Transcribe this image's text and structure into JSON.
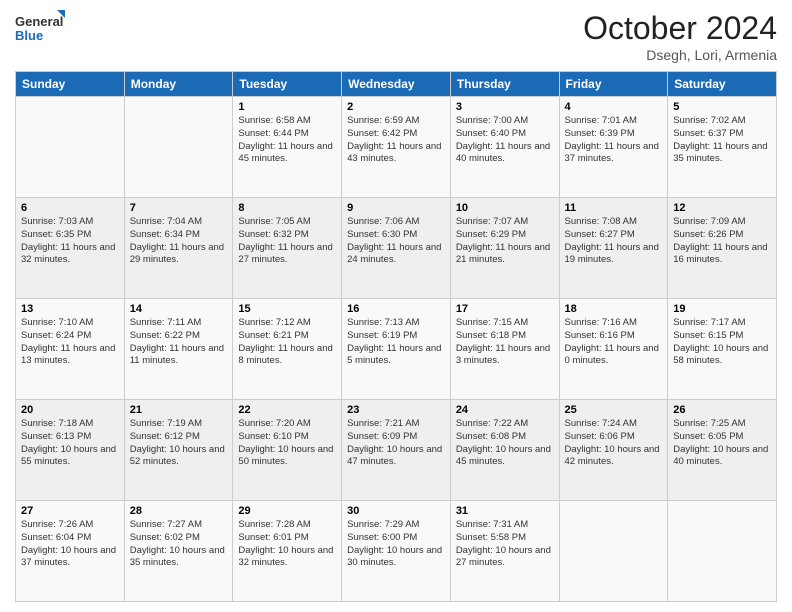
{
  "header": {
    "logo_general": "General",
    "logo_blue": "Blue",
    "month": "October 2024",
    "location": "Dsegh, Lori, Armenia"
  },
  "days_of_week": [
    "Sunday",
    "Monday",
    "Tuesday",
    "Wednesday",
    "Thursday",
    "Friday",
    "Saturday"
  ],
  "weeks": [
    [
      {
        "day": "",
        "info": ""
      },
      {
        "day": "",
        "info": ""
      },
      {
        "day": "1",
        "info": "Sunrise: 6:58 AM\nSunset: 6:44 PM\nDaylight: 11 hours and 45 minutes."
      },
      {
        "day": "2",
        "info": "Sunrise: 6:59 AM\nSunset: 6:42 PM\nDaylight: 11 hours and 43 minutes."
      },
      {
        "day": "3",
        "info": "Sunrise: 7:00 AM\nSunset: 6:40 PM\nDaylight: 11 hours and 40 minutes."
      },
      {
        "day": "4",
        "info": "Sunrise: 7:01 AM\nSunset: 6:39 PM\nDaylight: 11 hours and 37 minutes."
      },
      {
        "day": "5",
        "info": "Sunrise: 7:02 AM\nSunset: 6:37 PM\nDaylight: 11 hours and 35 minutes."
      }
    ],
    [
      {
        "day": "6",
        "info": "Sunrise: 7:03 AM\nSunset: 6:35 PM\nDaylight: 11 hours and 32 minutes."
      },
      {
        "day": "7",
        "info": "Sunrise: 7:04 AM\nSunset: 6:34 PM\nDaylight: 11 hours and 29 minutes."
      },
      {
        "day": "8",
        "info": "Sunrise: 7:05 AM\nSunset: 6:32 PM\nDaylight: 11 hours and 27 minutes."
      },
      {
        "day": "9",
        "info": "Sunrise: 7:06 AM\nSunset: 6:30 PM\nDaylight: 11 hours and 24 minutes."
      },
      {
        "day": "10",
        "info": "Sunrise: 7:07 AM\nSunset: 6:29 PM\nDaylight: 11 hours and 21 minutes."
      },
      {
        "day": "11",
        "info": "Sunrise: 7:08 AM\nSunset: 6:27 PM\nDaylight: 11 hours and 19 minutes."
      },
      {
        "day": "12",
        "info": "Sunrise: 7:09 AM\nSunset: 6:26 PM\nDaylight: 11 hours and 16 minutes."
      }
    ],
    [
      {
        "day": "13",
        "info": "Sunrise: 7:10 AM\nSunset: 6:24 PM\nDaylight: 11 hours and 13 minutes."
      },
      {
        "day": "14",
        "info": "Sunrise: 7:11 AM\nSunset: 6:22 PM\nDaylight: 11 hours and 11 minutes."
      },
      {
        "day": "15",
        "info": "Sunrise: 7:12 AM\nSunset: 6:21 PM\nDaylight: 11 hours and 8 minutes."
      },
      {
        "day": "16",
        "info": "Sunrise: 7:13 AM\nSunset: 6:19 PM\nDaylight: 11 hours and 5 minutes."
      },
      {
        "day": "17",
        "info": "Sunrise: 7:15 AM\nSunset: 6:18 PM\nDaylight: 11 hours and 3 minutes."
      },
      {
        "day": "18",
        "info": "Sunrise: 7:16 AM\nSunset: 6:16 PM\nDaylight: 11 hours and 0 minutes."
      },
      {
        "day": "19",
        "info": "Sunrise: 7:17 AM\nSunset: 6:15 PM\nDaylight: 10 hours and 58 minutes."
      }
    ],
    [
      {
        "day": "20",
        "info": "Sunrise: 7:18 AM\nSunset: 6:13 PM\nDaylight: 10 hours and 55 minutes."
      },
      {
        "day": "21",
        "info": "Sunrise: 7:19 AM\nSunset: 6:12 PM\nDaylight: 10 hours and 52 minutes."
      },
      {
        "day": "22",
        "info": "Sunrise: 7:20 AM\nSunset: 6:10 PM\nDaylight: 10 hours and 50 minutes."
      },
      {
        "day": "23",
        "info": "Sunrise: 7:21 AM\nSunset: 6:09 PM\nDaylight: 10 hours and 47 minutes."
      },
      {
        "day": "24",
        "info": "Sunrise: 7:22 AM\nSunset: 6:08 PM\nDaylight: 10 hours and 45 minutes."
      },
      {
        "day": "25",
        "info": "Sunrise: 7:24 AM\nSunset: 6:06 PM\nDaylight: 10 hours and 42 minutes."
      },
      {
        "day": "26",
        "info": "Sunrise: 7:25 AM\nSunset: 6:05 PM\nDaylight: 10 hours and 40 minutes."
      }
    ],
    [
      {
        "day": "27",
        "info": "Sunrise: 7:26 AM\nSunset: 6:04 PM\nDaylight: 10 hours and 37 minutes."
      },
      {
        "day": "28",
        "info": "Sunrise: 7:27 AM\nSunset: 6:02 PM\nDaylight: 10 hours and 35 minutes."
      },
      {
        "day": "29",
        "info": "Sunrise: 7:28 AM\nSunset: 6:01 PM\nDaylight: 10 hours and 32 minutes."
      },
      {
        "day": "30",
        "info": "Sunrise: 7:29 AM\nSunset: 6:00 PM\nDaylight: 10 hours and 30 minutes."
      },
      {
        "day": "31",
        "info": "Sunrise: 7:31 AM\nSunset: 5:58 PM\nDaylight: 10 hours and 27 minutes."
      },
      {
        "day": "",
        "info": ""
      },
      {
        "day": "",
        "info": ""
      }
    ]
  ]
}
